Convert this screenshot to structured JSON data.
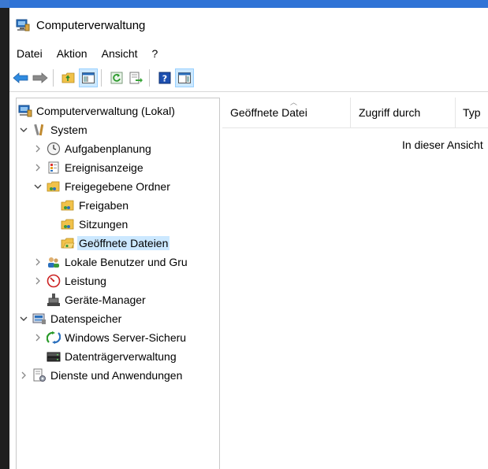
{
  "window": {
    "title": "Computerverwaltung"
  },
  "menu": [
    "Datei",
    "Aktion",
    "Ansicht",
    "?"
  ],
  "toolbar": {
    "buttons": [
      {
        "name": "back-arrow-icon"
      },
      {
        "name": "forward-arrow-icon"
      },
      {
        "name": "up-folder-icon"
      },
      {
        "name": "show-hide-console-tree-icon"
      },
      {
        "name": "refresh-icon"
      },
      {
        "name": "export-list-icon"
      },
      {
        "name": "help-icon"
      },
      {
        "name": "show-action-pane-icon"
      }
    ]
  },
  "tree": {
    "root": "Computerverwaltung (Lokal)",
    "system": "System",
    "aufgabenplanung": "Aufgabenplanung",
    "ereignisanzeige": "Ereignisanzeige",
    "freigegebene_ordner": "Freigegebene Ordner",
    "freigaben": "Freigaben",
    "sitzungen": "Sitzungen",
    "geoeffnete_dateien": "Geöffnete Dateien",
    "lokale_benutzer": "Lokale Benutzer und Gru",
    "leistung": "Leistung",
    "geraete_manager": "Geräte-Manager",
    "datenspeicher": "Datenspeicher",
    "windows_server_sicherung": "Windows Server-Sicheru",
    "datentraegerverwaltung": "Datenträgerverwaltung",
    "dienste": "Dienste und Anwendungen"
  },
  "list": {
    "columns": [
      "Geöffnete Datei",
      "Zugriff durch",
      "Typ"
    ],
    "empty_message": "In dieser Ansicht"
  }
}
